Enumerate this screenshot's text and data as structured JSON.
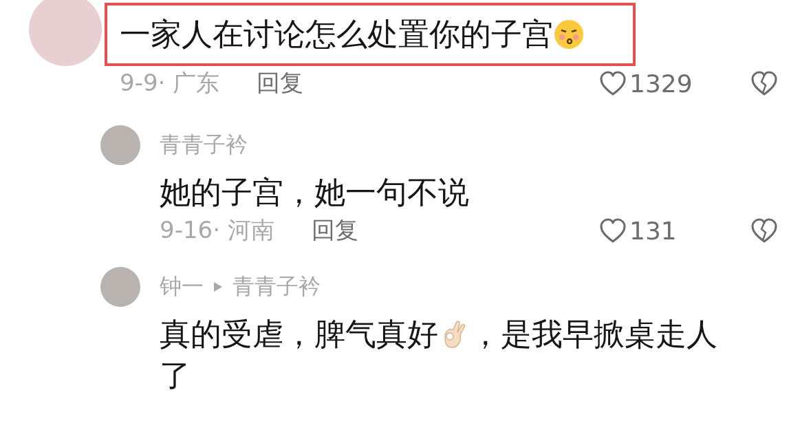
{
  "comments": [
    {
      "highlighted": true,
      "segments": [
        {
          "kind": "text",
          "text": "一家人在讨论怎么处置你的子宫"
        },
        {
          "kind": "face_emoji"
        }
      ],
      "date_location": "9-9· 广东",
      "reply": "回复",
      "likes": "1329",
      "replies": [
        {
          "author": "青青子衿",
          "segments": [
            {
              "kind": "text",
              "text": "她的子宫，她一句不说"
            }
          ],
          "date_location": "9-16· 河南",
          "reply": "回复",
          "likes": "131"
        },
        {
          "author": "钟一",
          "reply_to": "青青子衿",
          "segments": [
            {
              "kind": "text",
              "text": "真的受虐，脾气真好"
            },
            {
              "kind": "ok_emoji"
            },
            {
              "kind": "text",
              "text": "，是我早掀桌走人了"
            }
          ]
        }
      ]
    }
  ]
}
